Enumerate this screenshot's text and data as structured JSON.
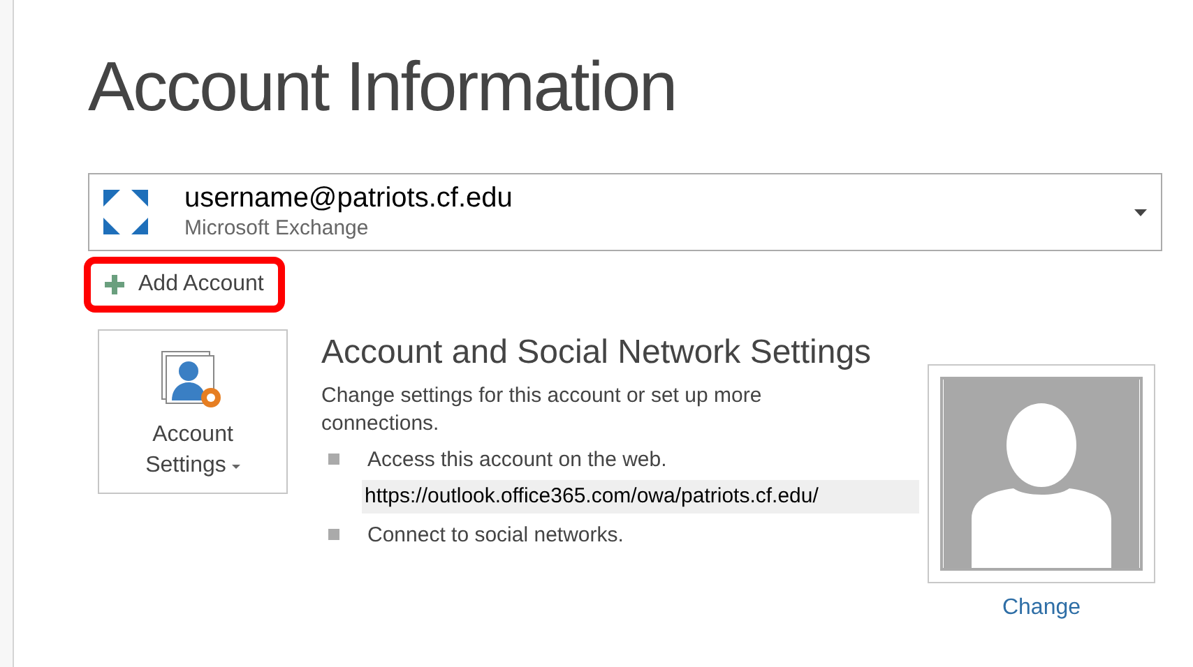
{
  "title": "Account Information",
  "account": {
    "email": "username@patriots.cf.edu",
    "type": "Microsoft Exchange"
  },
  "add_account": {
    "label": "Add Account",
    "highlighted": true
  },
  "settings_button": {
    "line1": "Account",
    "line2": "Settings"
  },
  "section": {
    "heading": "Account and Social Network Settings",
    "description": "Change settings for this account or set up more connections.",
    "bullets": [
      {
        "text": "Access this account on the web.",
        "link": "https://outlook.office365.com/owa/patriots.cf.edu/"
      },
      {
        "text": "Connect to social networks."
      }
    ]
  },
  "photo": {
    "change_link": "Change"
  }
}
